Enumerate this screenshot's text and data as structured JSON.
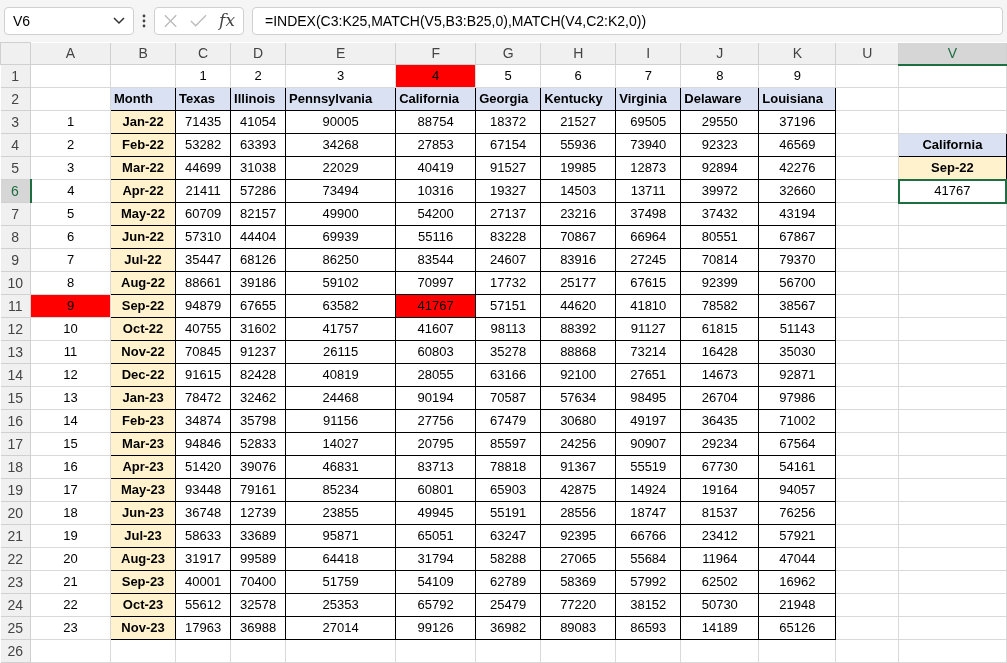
{
  "name_box": "V6",
  "function_label": "fx",
  "formula": "=INDEX(C3:K25,MATCH(V5,B3:B25,0),MATCH(V4,C2:K2,0))",
  "columns": [
    {
      "label": "A",
      "selected": false
    },
    {
      "label": "B",
      "selected": false
    },
    {
      "label": "C",
      "selected": false
    },
    {
      "label": "D",
      "selected": false
    },
    {
      "label": "E",
      "selected": false
    },
    {
      "label": "F",
      "selected": false
    },
    {
      "label": "G",
      "selected": false
    },
    {
      "label": "H",
      "selected": false
    },
    {
      "label": "I",
      "selected": false
    },
    {
      "label": "J",
      "selected": false
    },
    {
      "label": "K",
      "selected": false
    },
    {
      "label": "U",
      "selected": false
    },
    {
      "label": "V",
      "selected": true
    }
  ],
  "column_numbers": [
    {
      "text": "1",
      "highlighted": false
    },
    {
      "text": "2",
      "highlighted": false
    },
    {
      "text": "3",
      "highlighted": false
    },
    {
      "text": "4",
      "highlighted": true
    },
    {
      "text": "5",
      "highlighted": false
    },
    {
      "text": "6",
      "highlighted": false
    },
    {
      "text": "7",
      "highlighted": false
    },
    {
      "text": "8",
      "highlighted": false
    },
    {
      "text": "9",
      "highlighted": false
    }
  ],
  "table_header": [
    "Month",
    "Texas",
    "Illinois",
    "Pennsylvania",
    "California",
    "Georgia",
    "Kentucky",
    "Virginia",
    "Delaware",
    "Louisiana"
  ],
  "rows": [
    {
      "n": "1",
      "highlighted": false,
      "month": "Jan-22",
      "cells": [
        {
          "v": "71435",
          "hl": false
        },
        {
          "v": "41054",
          "hl": false
        },
        {
          "v": "90005",
          "hl": false
        },
        {
          "v": "88754",
          "hl": false
        },
        {
          "v": "18372",
          "hl": false
        },
        {
          "v": "21527",
          "hl": false
        },
        {
          "v": "69505",
          "hl": false
        },
        {
          "v": "29550",
          "hl": false
        },
        {
          "v": "37196",
          "hl": false
        }
      ]
    },
    {
      "n": "2",
      "highlighted": false,
      "month": "Feb-22",
      "cells": [
        {
          "v": "53282",
          "hl": false
        },
        {
          "v": "63393",
          "hl": false
        },
        {
          "v": "34268",
          "hl": false
        },
        {
          "v": "27853",
          "hl": false
        },
        {
          "v": "67154",
          "hl": false
        },
        {
          "v": "55936",
          "hl": false
        },
        {
          "v": "73940",
          "hl": false
        },
        {
          "v": "92323",
          "hl": false
        },
        {
          "v": "46569",
          "hl": false
        }
      ]
    },
    {
      "n": "3",
      "highlighted": false,
      "month": "Mar-22",
      "cells": [
        {
          "v": "44699",
          "hl": false
        },
        {
          "v": "31038",
          "hl": false
        },
        {
          "v": "22029",
          "hl": false
        },
        {
          "v": "40419",
          "hl": false
        },
        {
          "v": "91527",
          "hl": false
        },
        {
          "v": "19985",
          "hl": false
        },
        {
          "v": "12873",
          "hl": false
        },
        {
          "v": "92894",
          "hl": false
        },
        {
          "v": "42276",
          "hl": false
        }
      ]
    },
    {
      "n": "4",
      "highlighted": false,
      "month": "Apr-22",
      "cells": [
        {
          "v": "21411",
          "hl": false
        },
        {
          "v": "57286",
          "hl": false
        },
        {
          "v": "73494",
          "hl": false
        },
        {
          "v": "10316",
          "hl": false
        },
        {
          "v": "19327",
          "hl": false
        },
        {
          "v": "14503",
          "hl": false
        },
        {
          "v": "13711",
          "hl": false
        },
        {
          "v": "39972",
          "hl": false
        },
        {
          "v": "32660",
          "hl": false
        }
      ]
    },
    {
      "n": "5",
      "highlighted": false,
      "month": "May-22",
      "cells": [
        {
          "v": "60709",
          "hl": false
        },
        {
          "v": "82157",
          "hl": false
        },
        {
          "v": "49900",
          "hl": false
        },
        {
          "v": "54200",
          "hl": false
        },
        {
          "v": "27137",
          "hl": false
        },
        {
          "v": "23216",
          "hl": false
        },
        {
          "v": "37498",
          "hl": false
        },
        {
          "v": "37432",
          "hl": false
        },
        {
          "v": "43194",
          "hl": false
        }
      ]
    },
    {
      "n": "6",
      "highlighted": false,
      "month": "Jun-22",
      "cells": [
        {
          "v": "57310",
          "hl": false
        },
        {
          "v": "44404",
          "hl": false
        },
        {
          "v": "69939",
          "hl": false
        },
        {
          "v": "55116",
          "hl": false
        },
        {
          "v": "83228",
          "hl": false
        },
        {
          "v": "70867",
          "hl": false
        },
        {
          "v": "66964",
          "hl": false
        },
        {
          "v": "80551",
          "hl": false
        },
        {
          "v": "67867",
          "hl": false
        }
      ]
    },
    {
      "n": "7",
      "highlighted": false,
      "month": "Jul-22",
      "cells": [
        {
          "v": "35447",
          "hl": false
        },
        {
          "v": "68126",
          "hl": false
        },
        {
          "v": "86250",
          "hl": false
        },
        {
          "v": "83544",
          "hl": false
        },
        {
          "v": "24607",
          "hl": false
        },
        {
          "v": "83916",
          "hl": false
        },
        {
          "v": "27245",
          "hl": false
        },
        {
          "v": "70814",
          "hl": false
        },
        {
          "v": "79370",
          "hl": false
        }
      ]
    },
    {
      "n": "8",
      "highlighted": false,
      "month": "Aug-22",
      "cells": [
        {
          "v": "88661",
          "hl": false
        },
        {
          "v": "39186",
          "hl": false
        },
        {
          "v": "59102",
          "hl": false
        },
        {
          "v": "70997",
          "hl": false
        },
        {
          "v": "17732",
          "hl": false
        },
        {
          "v": "25177",
          "hl": false
        },
        {
          "v": "67615",
          "hl": false
        },
        {
          "v": "92399",
          "hl": false
        },
        {
          "v": "56700",
          "hl": false
        }
      ]
    },
    {
      "n": "9",
      "highlighted": true,
      "month": "Sep-22",
      "cells": [
        {
          "v": "94879",
          "hl": false
        },
        {
          "v": "67655",
          "hl": false
        },
        {
          "v": "63582",
          "hl": false
        },
        {
          "v": "41767",
          "hl": true
        },
        {
          "v": "57151",
          "hl": false
        },
        {
          "v": "44620",
          "hl": false
        },
        {
          "v": "41810",
          "hl": false
        },
        {
          "v": "78582",
          "hl": false
        },
        {
          "v": "38567",
          "hl": false
        }
      ]
    },
    {
      "n": "10",
      "highlighted": false,
      "month": "Oct-22",
      "cells": [
        {
          "v": "40755",
          "hl": false
        },
        {
          "v": "31602",
          "hl": false
        },
        {
          "v": "41757",
          "hl": false
        },
        {
          "v": "41607",
          "hl": false
        },
        {
          "v": "98113",
          "hl": false
        },
        {
          "v": "88392",
          "hl": false
        },
        {
          "v": "91127",
          "hl": false
        },
        {
          "v": "61815",
          "hl": false
        },
        {
          "v": "51143",
          "hl": false
        }
      ]
    },
    {
      "n": "11",
      "highlighted": false,
      "month": "Nov-22",
      "cells": [
        {
          "v": "70845",
          "hl": false
        },
        {
          "v": "91237",
          "hl": false
        },
        {
          "v": "26115",
          "hl": false
        },
        {
          "v": "60803",
          "hl": false
        },
        {
          "v": "35278",
          "hl": false
        },
        {
          "v": "88868",
          "hl": false
        },
        {
          "v": "73214",
          "hl": false
        },
        {
          "v": "16428",
          "hl": false
        },
        {
          "v": "35030",
          "hl": false
        }
      ]
    },
    {
      "n": "12",
      "highlighted": false,
      "month": "Dec-22",
      "cells": [
        {
          "v": "91615",
          "hl": false
        },
        {
          "v": "82428",
          "hl": false
        },
        {
          "v": "40819",
          "hl": false
        },
        {
          "v": "28055",
          "hl": false
        },
        {
          "v": "63166",
          "hl": false
        },
        {
          "v": "92100",
          "hl": false
        },
        {
          "v": "27651",
          "hl": false
        },
        {
          "v": "14673",
          "hl": false
        },
        {
          "v": "92871",
          "hl": false
        }
      ]
    },
    {
      "n": "13",
      "highlighted": false,
      "month": "Jan-23",
      "cells": [
        {
          "v": "78472",
          "hl": false
        },
        {
          "v": "32462",
          "hl": false
        },
        {
          "v": "24468",
          "hl": false
        },
        {
          "v": "90194",
          "hl": false
        },
        {
          "v": "70587",
          "hl": false
        },
        {
          "v": "57634",
          "hl": false
        },
        {
          "v": "98495",
          "hl": false
        },
        {
          "v": "26704",
          "hl": false
        },
        {
          "v": "97986",
          "hl": false
        }
      ]
    },
    {
      "n": "14",
      "highlighted": false,
      "month": "Feb-23",
      "cells": [
        {
          "v": "34874",
          "hl": false
        },
        {
          "v": "35798",
          "hl": false
        },
        {
          "v": "91156",
          "hl": false
        },
        {
          "v": "27756",
          "hl": false
        },
        {
          "v": "67479",
          "hl": false
        },
        {
          "v": "30680",
          "hl": false
        },
        {
          "v": "49197",
          "hl": false
        },
        {
          "v": "36435",
          "hl": false
        },
        {
          "v": "71002",
          "hl": false
        }
      ]
    },
    {
      "n": "15",
      "highlighted": false,
      "month": "Mar-23",
      "cells": [
        {
          "v": "94846",
          "hl": false
        },
        {
          "v": "52833",
          "hl": false
        },
        {
          "v": "14027",
          "hl": false
        },
        {
          "v": "20795",
          "hl": false
        },
        {
          "v": "85597",
          "hl": false
        },
        {
          "v": "24256",
          "hl": false
        },
        {
          "v": "90907",
          "hl": false
        },
        {
          "v": "29234",
          "hl": false
        },
        {
          "v": "67564",
          "hl": false
        }
      ]
    },
    {
      "n": "16",
      "highlighted": false,
      "month": "Apr-23",
      "cells": [
        {
          "v": "51420",
          "hl": false
        },
        {
          "v": "39076",
          "hl": false
        },
        {
          "v": "46831",
          "hl": false
        },
        {
          "v": "83713",
          "hl": false
        },
        {
          "v": "78818",
          "hl": false
        },
        {
          "v": "91367",
          "hl": false
        },
        {
          "v": "55519",
          "hl": false
        },
        {
          "v": "67730",
          "hl": false
        },
        {
          "v": "54161",
          "hl": false
        }
      ]
    },
    {
      "n": "17",
      "highlighted": false,
      "month": "May-23",
      "cells": [
        {
          "v": "93448",
          "hl": false
        },
        {
          "v": "79161",
          "hl": false
        },
        {
          "v": "85234",
          "hl": false
        },
        {
          "v": "60801",
          "hl": false
        },
        {
          "v": "65903",
          "hl": false
        },
        {
          "v": "42875",
          "hl": false
        },
        {
          "v": "14924",
          "hl": false
        },
        {
          "v": "19164",
          "hl": false
        },
        {
          "v": "94057",
          "hl": false
        }
      ]
    },
    {
      "n": "18",
      "highlighted": false,
      "month": "Jun-23",
      "cells": [
        {
          "v": "36748",
          "hl": false
        },
        {
          "v": "12739",
          "hl": false
        },
        {
          "v": "23855",
          "hl": false
        },
        {
          "v": "49945",
          "hl": false
        },
        {
          "v": "55191",
          "hl": false
        },
        {
          "v": "28556",
          "hl": false
        },
        {
          "v": "18747",
          "hl": false
        },
        {
          "v": "81537",
          "hl": false
        },
        {
          "v": "76256",
          "hl": false
        }
      ]
    },
    {
      "n": "19",
      "highlighted": false,
      "month": "Jul-23",
      "cells": [
        {
          "v": "58633",
          "hl": false
        },
        {
          "v": "33689",
          "hl": false
        },
        {
          "v": "95871",
          "hl": false
        },
        {
          "v": "65051",
          "hl": false
        },
        {
          "v": "63247",
          "hl": false
        },
        {
          "v": "92395",
          "hl": false
        },
        {
          "v": "66766",
          "hl": false
        },
        {
          "v": "23412",
          "hl": false
        },
        {
          "v": "57921",
          "hl": false
        }
      ]
    },
    {
      "n": "20",
      "highlighted": false,
      "month": "Aug-23",
      "cells": [
        {
          "v": "31917",
          "hl": false
        },
        {
          "v": "99589",
          "hl": false
        },
        {
          "v": "64418",
          "hl": false
        },
        {
          "v": "31794",
          "hl": false
        },
        {
          "v": "58288",
          "hl": false
        },
        {
          "v": "27065",
          "hl": false
        },
        {
          "v": "55684",
          "hl": false
        },
        {
          "v": "11964",
          "hl": false
        },
        {
          "v": "47044",
          "hl": false
        }
      ]
    },
    {
      "n": "21",
      "highlighted": false,
      "month": "Sep-23",
      "cells": [
        {
          "v": "40001",
          "hl": false
        },
        {
          "v": "70400",
          "hl": false
        },
        {
          "v": "51759",
          "hl": false
        },
        {
          "v": "54109",
          "hl": false
        },
        {
          "v": "62789",
          "hl": false
        },
        {
          "v": "58369",
          "hl": false
        },
        {
          "v": "57992",
          "hl": false
        },
        {
          "v": "62502",
          "hl": false
        },
        {
          "v": "16962",
          "hl": false
        }
      ]
    },
    {
      "n": "22",
      "highlighted": false,
      "month": "Oct-23",
      "cells": [
        {
          "v": "55612",
          "hl": false
        },
        {
          "v": "32578",
          "hl": false
        },
        {
          "v": "25353",
          "hl": false
        },
        {
          "v": "65792",
          "hl": false
        },
        {
          "v": "25479",
          "hl": false
        },
        {
          "v": "77220",
          "hl": false
        },
        {
          "v": "38152",
          "hl": false
        },
        {
          "v": "50730",
          "hl": false
        },
        {
          "v": "21948",
          "hl": false
        }
      ]
    },
    {
      "n": "23",
      "highlighted": false,
      "month": "Nov-23",
      "cells": [
        {
          "v": "17963",
          "hl": false
        },
        {
          "v": "36988",
          "hl": false
        },
        {
          "v": "27014",
          "hl": false
        },
        {
          "v": "99126",
          "hl": false
        },
        {
          "v": "36982",
          "hl": false
        },
        {
          "v": "89083",
          "hl": false
        },
        {
          "v": "86593",
          "hl": false
        },
        {
          "v": "14189",
          "hl": false
        },
        {
          "v": "65126",
          "hl": false
        }
      ]
    }
  ],
  "row_numbers": [
    {
      "label": "1",
      "selected": false
    },
    {
      "label": "2",
      "selected": false
    },
    {
      "label": "3",
      "selected": false
    },
    {
      "label": "4",
      "selected": false
    },
    {
      "label": "5",
      "selected": false
    },
    {
      "label": "6",
      "selected": true
    },
    {
      "label": "7",
      "selected": false
    },
    {
      "label": "8",
      "selected": false
    },
    {
      "label": "9",
      "selected": false
    },
    {
      "label": "10",
      "selected": false
    },
    {
      "label": "11",
      "selected": false
    },
    {
      "label": "12",
      "selected": false
    },
    {
      "label": "13",
      "selected": false
    },
    {
      "label": "14",
      "selected": false
    },
    {
      "label": "15",
      "selected": false
    },
    {
      "label": "16",
      "selected": false
    },
    {
      "label": "17",
      "selected": false
    },
    {
      "label": "18",
      "selected": false
    },
    {
      "label": "19",
      "selected": false
    },
    {
      "label": "20",
      "selected": false
    },
    {
      "label": "21",
      "selected": false
    },
    {
      "label": "22",
      "selected": false
    },
    {
      "label": "23",
      "selected": false
    },
    {
      "label": "24",
      "selected": false
    },
    {
      "label": "25",
      "selected": false
    },
    {
      "label": "26",
      "selected": false
    }
  ],
  "lookup": {
    "state": "California",
    "month": "Sep-22",
    "result": "41767",
    "result_selected": true
  }
}
